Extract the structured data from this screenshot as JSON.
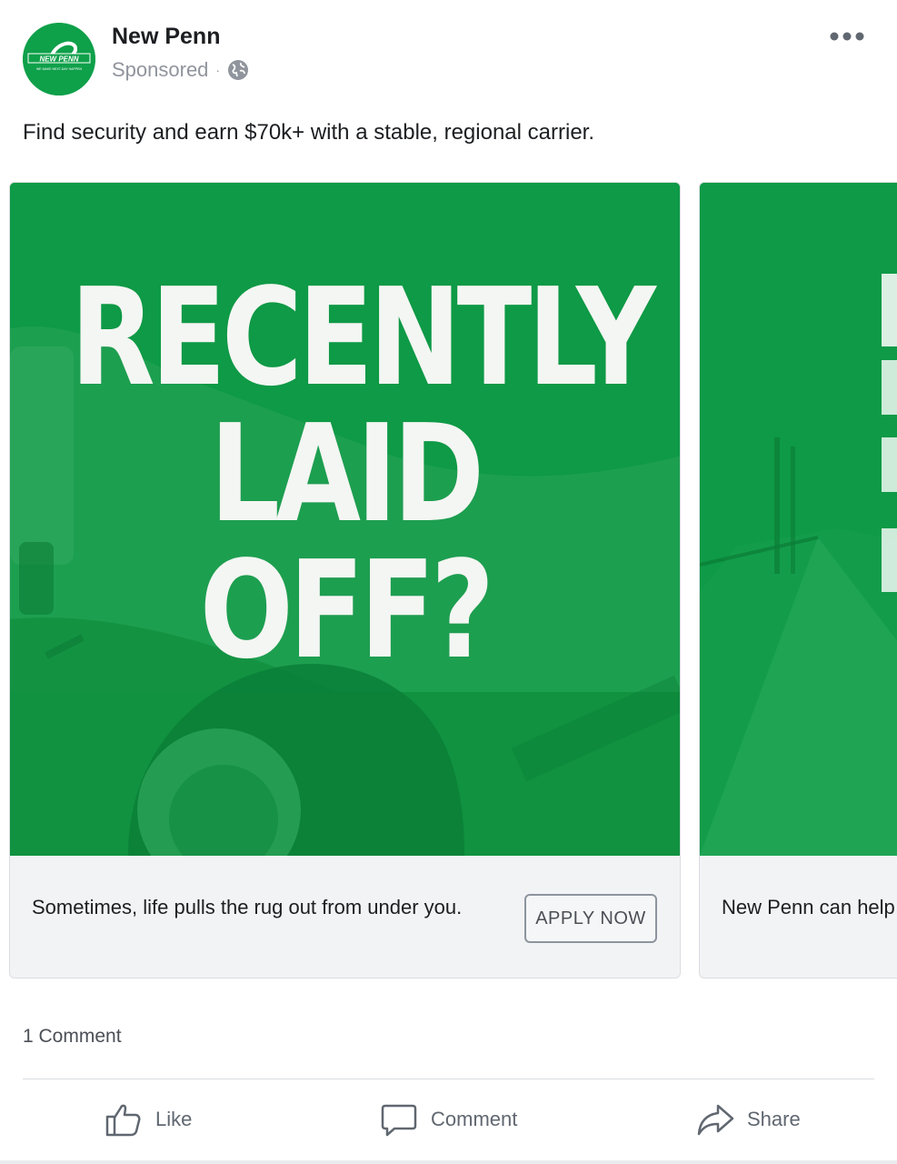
{
  "post": {
    "page_name": "New Penn",
    "sponsored_label": "Sponsored",
    "separator": "·",
    "caption": "Find security and earn $70k+ with a stable, regional carrier.",
    "logo": {
      "wordmark": "NEW PENN",
      "tagline": "WE MAKE NEXT-DAY HAPPEN"
    }
  },
  "carousel": {
    "cards": [
      {
        "image_text": [
          "RECENTLY",
          "LAID OFF?"
        ],
        "headline": "Sometimes, life pulls the rug out from under you.",
        "cta_label": "APPLY NOW"
      },
      {
        "image_text": [],
        "headline": "New Penn can help"
      }
    ]
  },
  "engagement": {
    "comments_count_text": "1 Comment"
  },
  "actions": {
    "like": "Like",
    "comment": "Comment",
    "share": "Share"
  },
  "colors": {
    "brand_green": "#0e9a46",
    "text_primary": "#1c1e21",
    "text_secondary": "#90949c",
    "action_gray": "#606770"
  },
  "icons": [
    "globe-icon",
    "more-options-icon",
    "like-icon",
    "comment-icon",
    "share-icon"
  ]
}
